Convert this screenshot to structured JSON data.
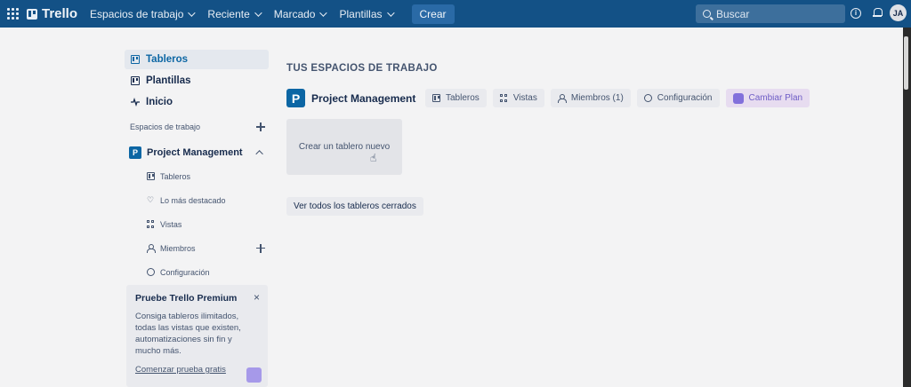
{
  "topbar": {
    "brand": "Trello",
    "nav": [
      "Espacios de trabajo",
      "Reciente",
      "Marcado",
      "Plantillas"
    ],
    "create_label": "Crear",
    "search_placeholder": "Buscar",
    "avatar_initials": "JA",
    "bar_color": "#135186"
  },
  "sidebar": {
    "nav_items": [
      {
        "label": "Tableros",
        "icon": "board-icon",
        "active": true
      },
      {
        "label": "Plantillas",
        "icon": "template-icon"
      },
      {
        "label": "Inicio",
        "icon": "pulse-icon"
      }
    ],
    "section_label": "Espacios de trabajo",
    "workspace": {
      "badge": "P",
      "name": "Project Management"
    },
    "sub_items": [
      {
        "label": "Tableros",
        "icon": "board-icon"
      },
      {
        "label": "Lo más destacado",
        "icon": "heart-icon"
      },
      {
        "label": "Vistas",
        "icon": "grid-icon"
      },
      {
        "label": "Miembros",
        "icon": "person-icon"
      },
      {
        "label": "Configuración",
        "icon": "gear-icon"
      }
    ]
  },
  "premium": {
    "title": "Pruebe Trello Premium",
    "close": "×",
    "description": "Consiga tableros ilimitados, todas las vistas que existen, automatizaciones sin fin y mucho más.",
    "link": "Comenzar prueba gratis"
  },
  "main": {
    "heading": "TUS ESPACIOS DE TRABAJO",
    "workspace_badge": "P",
    "workspace_name": "Project Management",
    "tabs": [
      {
        "label": "Tableros",
        "icon": "board-icon"
      },
      {
        "label": "Vistas",
        "icon": "grid-icon"
      },
      {
        "label": "Miembros (1)",
        "icon": "person-icon"
      },
      {
        "label": "Configuración",
        "icon": "gear-icon"
      },
      {
        "label": "Cambiar Plan",
        "icon": "plan-icon"
      }
    ],
    "create_board": "Crear un tablero nuevo",
    "closed_boards": "Ver todos los tableros cerrados"
  }
}
